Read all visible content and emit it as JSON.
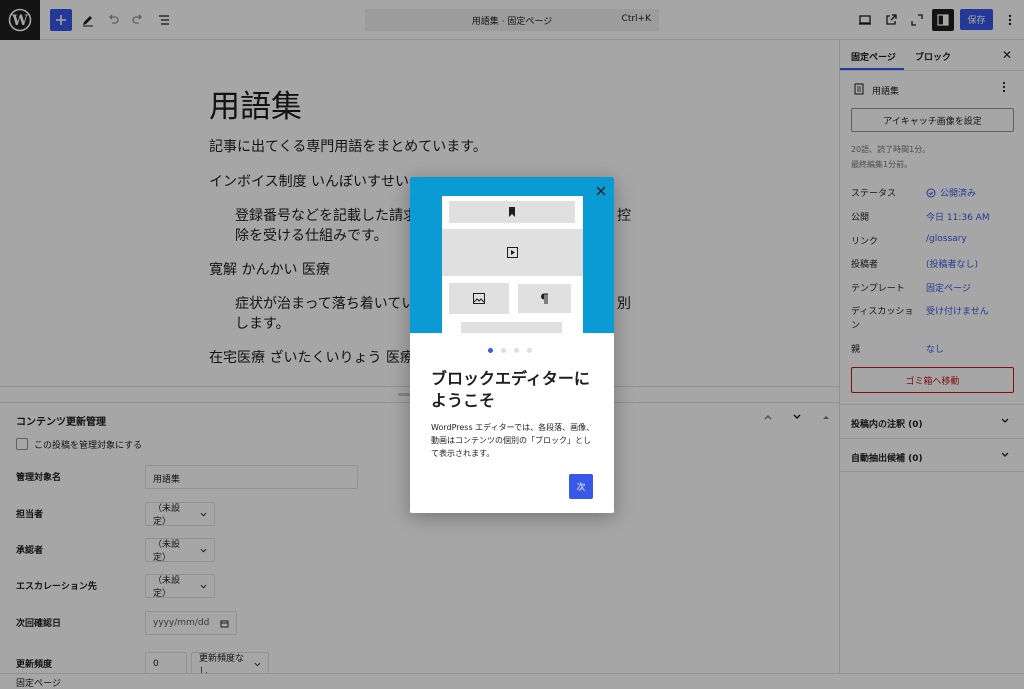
{
  "topbar": {
    "command_title": "用語集 · 固定ページ",
    "command_shortcut": "Ctrl+K",
    "save_label": "保存"
  },
  "editor": {
    "title": "用語集",
    "paragraphs": [
      "記事に出てくる専門用語をまとめています。",
      "インボイス制度 いんぼいすせい",
      "登録番号などを記載した請求",
      "控",
      "除を受ける仕組みです。",
      "寛解 かんかい 医療",
      "症状が治まって落ち着いてい",
      "別",
      "します。",
      "在宅医療 ざいたくいりょう 医療"
    ]
  },
  "metabox": {
    "title": "コンテンツ更新管理",
    "checkbox_label": "この投稿を管理対象にする",
    "fields": {
      "target_name_label": "管理対象名",
      "target_name_value": "用語集",
      "assignee_label": "担当者",
      "assignee_value": "（未設定）",
      "approver_label": "承認者",
      "approver_value": "（未設定）",
      "escalation_label": "エスカレーション先",
      "escalation_value": "（未設定）",
      "next_check_label": "次回確認日",
      "next_check_placeholder": "yyyy/mm/dd",
      "frequency_label": "更新頻度",
      "frequency_value": "0",
      "frequency_unit": "更新頻度なし"
    }
  },
  "footer": {
    "breadcrumb": "固定ページ"
  },
  "sidebar": {
    "tab_page": "固定ページ",
    "tab_block": "ブロック",
    "doc_title": "用語集",
    "featured_image_button": "アイキャッチ画像を設定",
    "meta_line1": "20語、読了時間1分。",
    "meta_line2": "最終編集1分前。",
    "rows": [
      {
        "label": "ステータス",
        "value": "公開済み"
      },
      {
        "label": "公開",
        "value": "今日 11:36 AM"
      },
      {
        "label": "リンク",
        "value": "/glossary"
      },
      {
        "label": "投稿者",
        "value": "(投稿者なし)"
      },
      {
        "label": "テンプレート",
        "value": "固定ページ"
      },
      {
        "label": "ディスカッショ",
        "label2": "ン",
        "value": "受け付けません"
      },
      {
        "label": "親",
        "value": "なし"
      }
    ],
    "trash_button": "ゴミ箱へ移動",
    "panels": [
      {
        "title": "投稿内の注釈 (0)"
      },
      {
        "title": "自動抽出候補 (0)"
      }
    ]
  },
  "modal": {
    "heading_line1": "ブロックエディターに",
    "heading_line2": "ようこそ",
    "body": "WordPress エディターでは、各段落、画像、動画はコンテンツの個別の「ブロック」として表示されます。",
    "next_label": "次",
    "current_step": 1,
    "total_steps": 4
  },
  "colors": {
    "accent": "#3858e9",
    "hero": "#0a9bd5",
    "danger": "#cc1818"
  }
}
